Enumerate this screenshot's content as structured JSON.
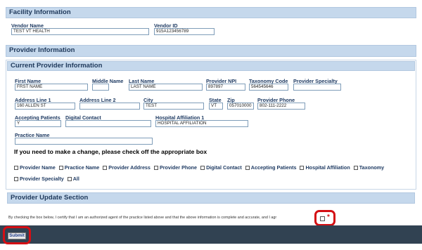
{
  "facility": {
    "section_title": "Facility Information",
    "vendor_name_label": "Vendor Name",
    "vendor_name_value": "TEST VT HEALTH",
    "vendor_id_label": "Vendor ID",
    "vendor_id_value": "915A123456789"
  },
  "provider": {
    "section_title": "Provider Information",
    "current_title": "Current Provider Information",
    "fields": {
      "first_name": {
        "label": "First Name",
        "value": "FRST NAME"
      },
      "middle_name": {
        "label": "Middle Name",
        "value": ""
      },
      "last_name": {
        "label": "Last Name",
        "value": "LAST NAME"
      },
      "npi": {
        "label": "Provider NPI",
        "value": "897897"
      },
      "taxonomy": {
        "label": "Taxonomy Code",
        "value": "564545646"
      },
      "specialty": {
        "label": "Provider Specialty",
        "value": ""
      },
      "address1": {
        "label": "Address Line 1",
        "value": "160 ALLEN ST"
      },
      "address2": {
        "label": "Address Line 2",
        "value": ""
      },
      "city": {
        "label": "City",
        "value": "TEST"
      },
      "state": {
        "label": "State",
        "value": "VT"
      },
      "zip": {
        "label": "Zip",
        "value": "057010000"
      },
      "phone": {
        "label": "Provider Phone",
        "value": "802-111-2222"
      },
      "accepting": {
        "label": "Accepting Patients",
        "value": "Y"
      },
      "digital": {
        "label": "Digital Contact",
        "value": ""
      },
      "hospital": {
        "label": "Hospital Affiliation 1",
        "value": "HOSPITAL AFFILIATION"
      },
      "practice": {
        "label": "Practice Name",
        "value": ""
      }
    }
  },
  "change_notice": "If you need to make a change, please check off the appropriate box",
  "checkboxes": {
    "provider_name": "Provider Name",
    "practice_name": "Practice Name",
    "provider_address": "Provider Address",
    "provider_phone": "Provider Phone",
    "digital_contact": "Digital Contact",
    "accepting_patients": "Accepting Patients",
    "hospital_affiliation": "Hospital Affiliation",
    "taxonomy": "Taxonomy",
    "provider_specialty": "Provider Specialty",
    "all": "All"
  },
  "update_section_title": "Provider Update Section",
  "certification_text": "By checking the box below, I certify that I am an authorized agent of the practice listed above and that the above information is complete and accurate, and I agr",
  "required_marker": "*",
  "submit_label": "Submit",
  "colors": {
    "header_bar": "#c5d8ec",
    "footer": "#314252",
    "highlight_ring": "#d40f14"
  }
}
